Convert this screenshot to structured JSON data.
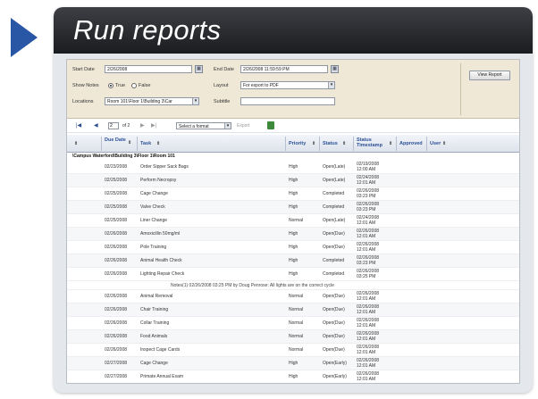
{
  "title": "Run reports",
  "colors": {
    "accent": "#2a56a6",
    "titlebar": "#2a2b2f"
  },
  "filters": {
    "start_date_label": "Start Date",
    "start_date_value": "2/26/2008",
    "end_date_label": "End Date",
    "end_date_value": "2/26/2008 11:59:59 PM",
    "show_notes_label": "Show Notes",
    "true_label": "True",
    "false_label": "False",
    "layout_label": "Layout",
    "layout_value": "For export to PDF",
    "locations_label": "Locations",
    "locations_value": "Room 101\\Floor 1\\Building 3\\Car",
    "subtitle_label": "Subtitle",
    "subtitle_value": "",
    "view_report_label": "View Report"
  },
  "toolbar": {
    "first": "|◀",
    "prev": "◀",
    "page_value": "2",
    "page_of": "of 2",
    "next": "▶",
    "last": "▶|",
    "format_value": "Select a format",
    "export_label": "Export"
  },
  "columns": {
    "due_date": "Due Date",
    "task": "Task",
    "priority": "Priority",
    "status": "Status",
    "status_timestamp": "Status Timestamp",
    "approved": "Approved",
    "user": "User"
  },
  "group_label": "\\Campus Waterford\\Building 3\\Floor 1\\Room 101",
  "rows": [
    {
      "date": "02/23/2008",
      "task": "Order Sipper Sack Bags",
      "priority": "High",
      "status": "Open(Late)",
      "ts1": "02/19/2008",
      "ts2": "12:00 AM"
    },
    {
      "date": "02/25/2008",
      "task": "Perform Necropsy",
      "priority": "High",
      "status": "Open(Late)",
      "ts1": "02/24/2008",
      "ts2": "12:01 AM"
    },
    {
      "date": "02/25/2008",
      "task": "Cage Change",
      "priority": "High",
      "status": "Completed",
      "ts1": "02/26/2008",
      "ts2": "03:23 PM"
    },
    {
      "date": "02/25/2008",
      "task": "Valve Check",
      "priority": "High",
      "status": "Completed",
      "ts1": "02/26/2008",
      "ts2": "03:23 PM"
    },
    {
      "date": "02/25/2008",
      "task": "Liner Change",
      "priority": "Normal",
      "status": "Open(Late)",
      "ts1": "02/24/2008",
      "ts2": "12:01 AM"
    },
    {
      "date": "02/26/2008",
      "task": "Amoxicillin 50mg/ml",
      "priority": "High",
      "status": "Open(Due)",
      "ts1": "02/26/2008",
      "ts2": "12:01 AM"
    },
    {
      "date": "02/26/2008",
      "task": "Pole Training",
      "priority": "High",
      "status": "Open(Due)",
      "ts1": "02/26/2008",
      "ts2": "12:01 AM"
    },
    {
      "date": "02/26/2008",
      "task": "Animal Health Check",
      "priority": "High",
      "status": "Completed",
      "ts1": "02/26/2008",
      "ts2": "03:23 PM"
    },
    {
      "date": "02/26/2008",
      "task": "Lighting Repair Check",
      "priority": "High",
      "status": "Completed",
      "ts1": "02/26/2008",
      "ts2": "03:25 PM"
    },
    {
      "note": "Notes(1) 02/26/2008 03:25 PM by Doug Penrose: All lights are on the correct cycle"
    },
    {
      "date": "02/26/2008",
      "task": "Animal Removal",
      "priority": "Normal",
      "status": "Open(Due)",
      "ts1": "02/26/2008",
      "ts2": "12:01 AM"
    },
    {
      "date": "02/26/2008",
      "task": "Chair Training",
      "priority": "Normal",
      "status": "Open(Due)",
      "ts1": "02/26/2008",
      "ts2": "12:01 AM"
    },
    {
      "date": "02/26/2008",
      "task": "Collar Training",
      "priority": "Normal",
      "status": "Open(Due)",
      "ts1": "02/26/2008",
      "ts2": "12:01 AM"
    },
    {
      "date": "02/26/2008",
      "task": "Food Animals",
      "priority": "Normal",
      "status": "Open(Due)",
      "ts1": "02/26/2008",
      "ts2": "12:01 AM"
    },
    {
      "date": "02/26/2008",
      "task": "Inspect Cage Cards",
      "priority": "Normal",
      "status": "Open(Due)",
      "ts1": "02/26/2008",
      "ts2": "12:01 AM"
    },
    {
      "date": "02/27/2008",
      "task": "Cage Change",
      "priority": "High",
      "status": "Open(Early)",
      "ts1": "02/26/2008",
      "ts2": "12:01 AM"
    },
    {
      "date": "02/27/2008",
      "task": "Primate Annual Exam",
      "priority": "High",
      "status": "Open(Early)",
      "ts1": "02/26/2008",
      "ts2": "12:01 AM"
    }
  ]
}
